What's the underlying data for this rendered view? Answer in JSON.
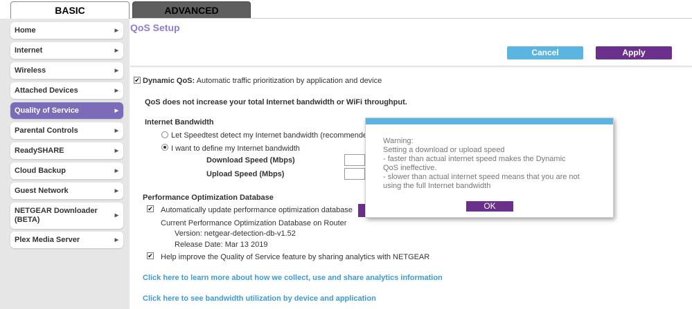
{
  "tabs": {
    "basic": "BASIC",
    "advanced": "ADVANCED"
  },
  "sidebar": {
    "items": [
      {
        "label": "Home"
      },
      {
        "label": "Internet"
      },
      {
        "label": "Wireless"
      },
      {
        "label": "Attached Devices"
      },
      {
        "label": "Quality of Service",
        "active": true
      },
      {
        "label": "Parental Controls"
      },
      {
        "label": "ReadySHARE"
      },
      {
        "label": "Cloud Backup"
      },
      {
        "label": "Guest Network"
      },
      {
        "label": "NETGEAR Downloader (BETA)"
      },
      {
        "label": "Plex Media Server"
      }
    ]
  },
  "page": {
    "title": "QoS Setup",
    "cancel": "Cancel",
    "apply": "Apply"
  },
  "qos": {
    "dynamic_label": "Dynamic QoS:",
    "dynamic_desc": "Automatic traffic prioritization by application and device",
    "dynamic_checked": true,
    "note": "QoS does not increase your total Internet bandwidth or WiFi throughput.",
    "bandwidth_heading": "Internet Bandwidth",
    "opt_speedtest": "Let Speedtest detect my Internet bandwidth (recommended)",
    "opt_define": "I want to define my Internet bandwidth",
    "selected": "define",
    "download_label": "Download Speed (Mbps)",
    "upload_label": "Upload Speed (Mbps)",
    "download_value": "",
    "upload_value": ""
  },
  "perf": {
    "heading": "Performance Optimization Database",
    "auto_update": "Automatically update performance optimization database",
    "current": "Current Performance Optimization Database on Router",
    "version": "Version: netgear-detection-db-v1.52",
    "release": "Release Date: Mar 13 2019",
    "analytics": "Help improve the Quality of Service feature by sharing analytics with NETGEAR"
  },
  "links": {
    "analytics_info": "Click here to learn more about how we collect, use and share analytics information",
    "bandwidth_util": "Click here to see bandwidth utilization by device and application"
  },
  "dialog": {
    "lines": [
      "Warning:",
      "Setting a download or upload speed",
      "- faster than actual internet speed makes the Dynamic",
      "QoS ineffective.",
      "- slower than actual internet speed means that you are not",
      "using the full Internet bandwidth"
    ],
    "ok": "OK"
  },
  "colors": {
    "accent_purple": "#6b2f8c",
    "accent_blue": "#5bb5e0",
    "title_purple": "#8b7ed0",
    "active_nav": "#7b6bb8"
  }
}
